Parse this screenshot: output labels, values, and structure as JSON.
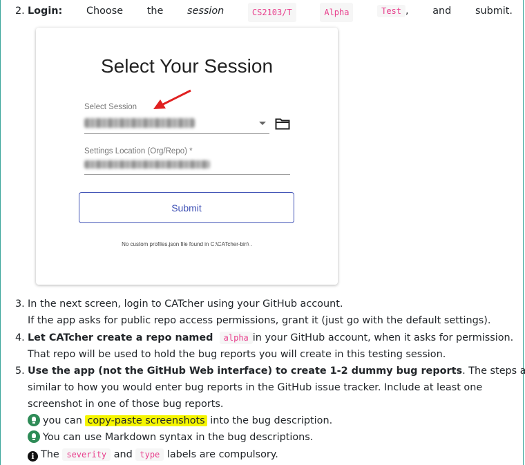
{
  "step2": {
    "num": "2.",
    "words": [
      "Login:",
      "Choose",
      "the",
      "session",
      "CS2103/T",
      "Alpha",
      "Test",
      ",",
      "and",
      "submit."
    ]
  },
  "card": {
    "title": "Select Your Session",
    "session_label": "Select Session",
    "location_label": "Settings Location (Org/Repo) *",
    "submit_label": "Submit",
    "note": "No custom profiles.json file found in C:\\CATcher-bin\\ ."
  },
  "step3": {
    "num": "3.",
    "line1": "In the next screen, login to CATcher using your GitHub account.",
    "line2": "If the app asks for public repo access permissions, grant it (just go with the default settings)."
  },
  "step4": {
    "num": "4.",
    "bold": "Let CATcher create a repo named",
    "code": "alpha",
    "rest1": "in your GitHub account, when it asks for permission.",
    "line2": "That repo will be used to hold the bug reports you will create in this testing session."
  },
  "step5": {
    "num": "5.",
    "bold": "Use the app (not the GitHub Web interface) to create 1-2 dummy bug reports",
    "rest1": ". The steps are",
    "line2": "similar to how you would enter bug reports in the GitHub issue tracker. Include at least one",
    "line3": "screenshot in one of those bug reports.",
    "tip1_pre": "you can",
    "tip1_hl": "copy-paste screenshots",
    "tip1_post": "into the bug description.",
    "tip2": "You can use Markdown syntax in the bug descriptions.",
    "info_pre": "The",
    "info_code1": "severity",
    "info_mid": "and",
    "info_code2": "type",
    "info_post": "labels are compulsory."
  },
  "colors": {
    "accent": "#3f51b5",
    "code": "#e83e8c",
    "highlight": "#f5f500",
    "tip": "#2e8b57",
    "arrow": "#e02020"
  }
}
